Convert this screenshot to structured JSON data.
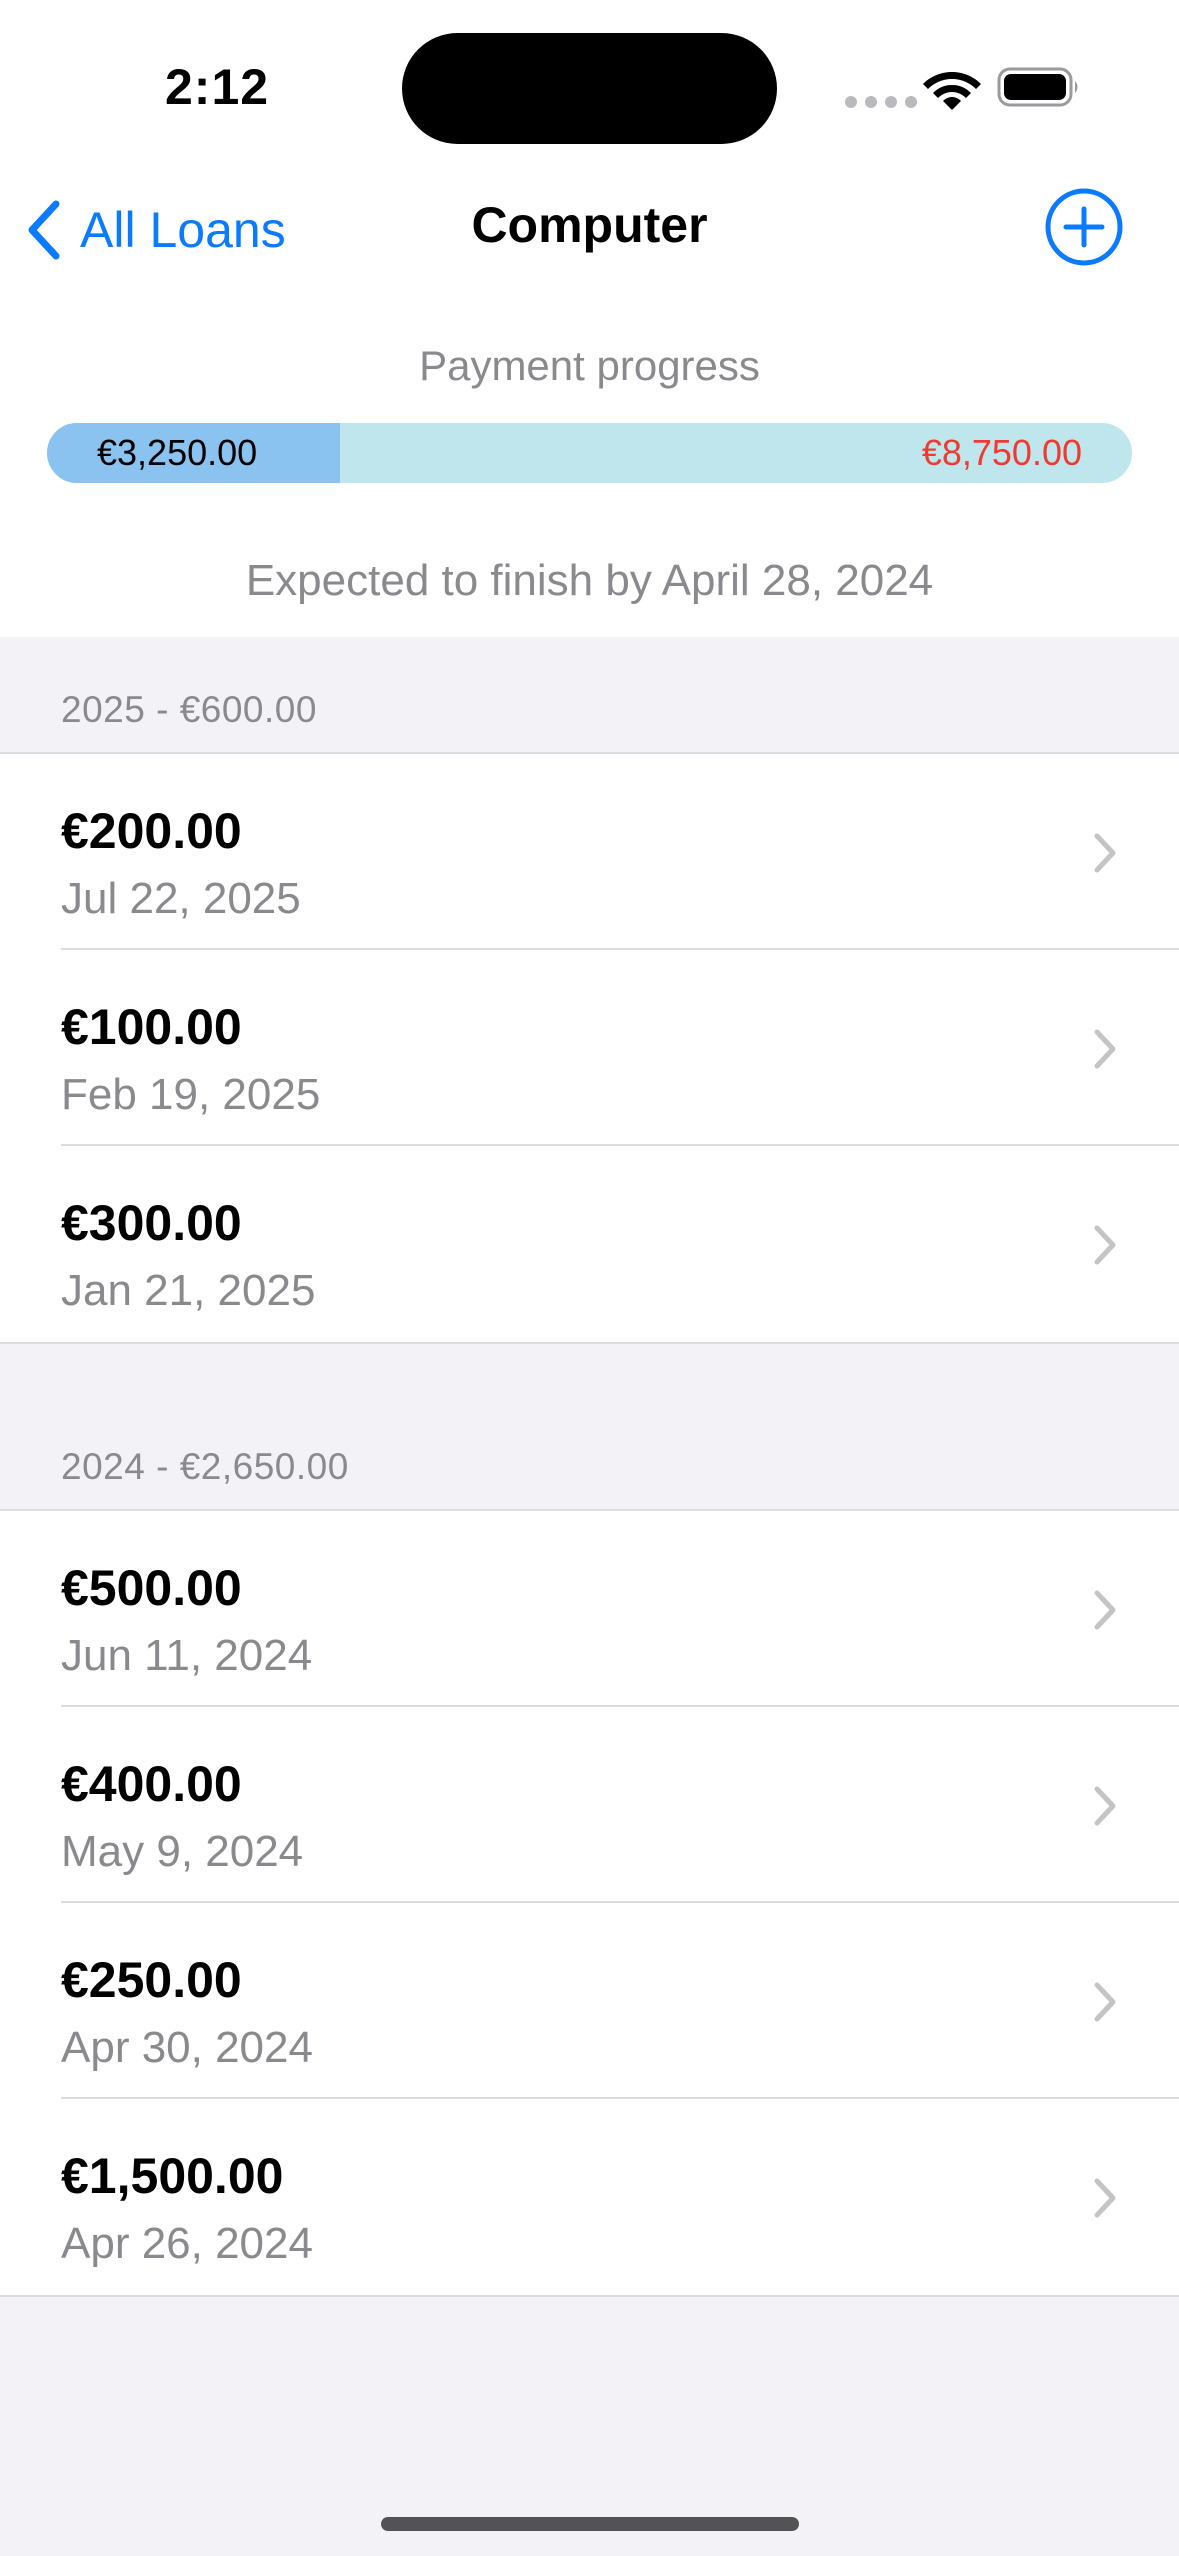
{
  "status_bar": {
    "time": "2:12"
  },
  "nav": {
    "back_label": "All Loans",
    "title": "Computer"
  },
  "progress": {
    "label": "Payment progress",
    "paid": "€3,250.00",
    "remaining": "€8,750.00",
    "paid_fraction": 0.27,
    "expected_finish": "Expected to finish by April 28, 2024"
  },
  "sections": [
    {
      "header": "2025 - €600.00",
      "rows": [
        {
          "amount": "€200.00",
          "date": "Jul 22, 2025"
        },
        {
          "amount": "€100.00",
          "date": "Feb 19, 2025"
        },
        {
          "amount": "€300.00",
          "date": "Jan 21, 2025"
        }
      ]
    },
    {
      "header": "2024 - €2,650.00",
      "rows": [
        {
          "amount": "€500.00",
          "date": "Jun 11, 2024"
        },
        {
          "amount": "€400.00",
          "date": "May 9, 2024"
        },
        {
          "amount": "€250.00",
          "date": "Apr 30, 2024"
        },
        {
          "amount": "€1,500.00",
          "date": "Apr 26, 2024"
        }
      ]
    }
  ],
  "colors": {
    "accent": "#0a7aff",
    "paid_fill": "#8ac3ef",
    "bar_background": "#bfe6ed",
    "remaining_text": "#ef3b2f"
  }
}
